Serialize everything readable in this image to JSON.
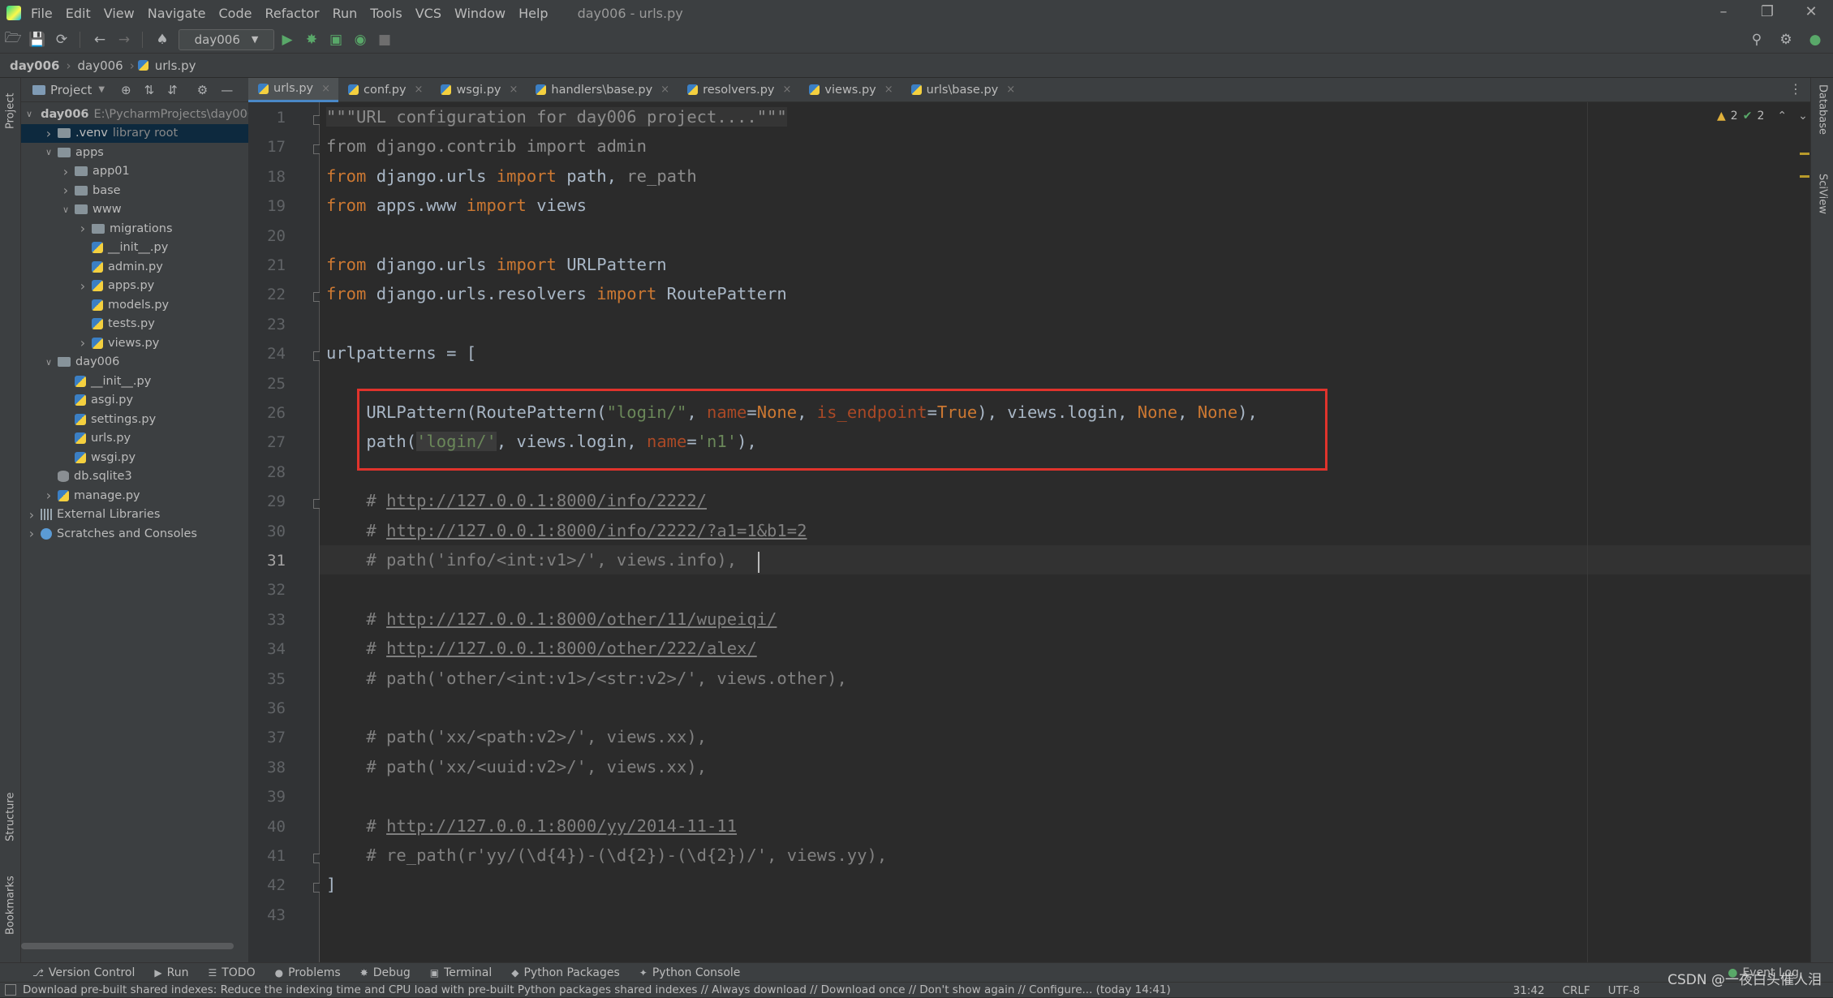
{
  "menu": {
    "items": [
      "File",
      "Edit",
      "View",
      "Navigate",
      "Code",
      "Refactor",
      "Run",
      "Tools",
      "VCS",
      "Window",
      "Help"
    ],
    "window_title": "day006 - urls.py"
  },
  "toolbar": {
    "run_config": "day006"
  },
  "breadcrumb": [
    "day006",
    "day006",
    "urls.py"
  ],
  "project_panel": {
    "title": "Project",
    "tree": [
      {
        "label": "day006",
        "extra": "E:\\PycharmProjects\\day006",
        "depth": 0,
        "expanded": true,
        "kind": "folder",
        "bold": true
      },
      {
        "label": ".venv",
        "extra": "library root",
        "depth": 1,
        "expanded": false,
        "kind": "folder",
        "selected": true
      },
      {
        "label": "apps",
        "depth": 1,
        "expanded": true,
        "kind": "folder"
      },
      {
        "label": "app01",
        "depth": 2,
        "expanded": false,
        "kind": "folder"
      },
      {
        "label": "base",
        "depth": 2,
        "expanded": false,
        "kind": "folder"
      },
      {
        "label": "www",
        "depth": 2,
        "expanded": true,
        "kind": "folder"
      },
      {
        "label": "migrations",
        "depth": 3,
        "expanded": false,
        "kind": "folder"
      },
      {
        "label": "__init__.py",
        "depth": 3,
        "kind": "py"
      },
      {
        "label": "admin.py",
        "depth": 3,
        "kind": "py"
      },
      {
        "label": "apps.py",
        "depth": 3,
        "expanded": false,
        "kind": "py"
      },
      {
        "label": "models.py",
        "depth": 3,
        "kind": "py"
      },
      {
        "label": "tests.py",
        "depth": 3,
        "kind": "py"
      },
      {
        "label": "views.py",
        "depth": 3,
        "expanded": false,
        "kind": "py"
      },
      {
        "label": "day006",
        "depth": 1,
        "expanded": true,
        "kind": "folder"
      },
      {
        "label": "__init__.py",
        "depth": 2,
        "kind": "py"
      },
      {
        "label": "asgi.py",
        "depth": 2,
        "kind": "py"
      },
      {
        "label": "settings.py",
        "depth": 2,
        "kind": "py"
      },
      {
        "label": "urls.py",
        "depth": 2,
        "kind": "py"
      },
      {
        "label": "wsgi.py",
        "depth": 2,
        "kind": "py"
      },
      {
        "label": "db.sqlite3",
        "depth": 1,
        "kind": "db"
      },
      {
        "label": "manage.py",
        "depth": 1,
        "expanded": false,
        "kind": "py"
      },
      {
        "label": "External Libraries",
        "depth": 0,
        "expanded": false,
        "kind": "lib"
      },
      {
        "label": "Scratches and Consoles",
        "depth": 0,
        "expanded": false,
        "kind": "scratch"
      }
    ]
  },
  "tabs": [
    {
      "label": "urls.py",
      "active": true
    },
    {
      "label": "conf.py"
    },
    {
      "label": "wsgi.py"
    },
    {
      "label": "handlers\\base.py"
    },
    {
      "label": "resolvers.py"
    },
    {
      "label": "views.py"
    },
    {
      "label": "urls\\base.py"
    }
  ],
  "inspections": {
    "warnings": "2",
    "ok": "2"
  },
  "editor": {
    "current_line": "31",
    "lines": [
      {
        "n": "1",
        "html": "<span class=\"docs\">\"\"\"URL configuration for day006 project....\"\"\"</span>",
        "fold": true
      },
      {
        "n": "17",
        "html": "<span class=\"grey\">from django.contrib import admin</span>",
        "fold": true
      },
      {
        "n": "18",
        "html": "<span class=\"kw\">from</span> django.urls <span class=\"kw\">import</span> path, <span class=\"grey\">re_path</span>"
      },
      {
        "n": "19",
        "html": "<span class=\"kw\">from</span> apps.www <span class=\"kw\">import</span> views"
      },
      {
        "n": "20",
        "html": ""
      },
      {
        "n": "21",
        "html": "<span class=\"kw\">from</span> django.urls <span class=\"kw\">import</span> URLPattern"
      },
      {
        "n": "22",
        "html": "<span class=\"kw\">from</span> django.urls.resolvers <span class=\"kw\">import</span> RoutePattern",
        "fold": true
      },
      {
        "n": "23",
        "html": ""
      },
      {
        "n": "24",
        "html": "urlpatterns = [",
        "fold": true
      },
      {
        "n": "25",
        "html": ""
      },
      {
        "n": "26",
        "html": "    URLPattern(RoutePattern(<span class=\"str\">\"login/\"</span>, <span class=\"kwarg\">name</span>=<span class=\"kw\">None</span>, <span class=\"kwarg\">is_endpoint</span>=<span class=\"kw\">True</span>), views.login, <span class=\"kw\">None</span>, <span class=\"kw\">None</span>),"
      },
      {
        "n": "27",
        "html": "    path(<span class=\"strhl\">'login/'</span>, views.login, <span class=\"kwarg\">name</span>=<span class=\"str\">'n1'</span>),"
      },
      {
        "n": "28",
        "html": ""
      },
      {
        "n": "29",
        "html": "    <span class=\"cm\"># </span><span class=\"link\">http://127.0.0.1:8000/info/2222/</span>",
        "fold": true
      },
      {
        "n": "30",
        "html": "    <span class=\"cm\"># </span><span class=\"link\">http://127.0.0.1:8000/info/2222/?a1=1&amp;b1=2</span>"
      },
      {
        "n": "31",
        "html": "    <span class=\"cm\"># path('info/&lt;int:v1&gt;/', views.info),</span>"
      },
      {
        "n": "32",
        "html": ""
      },
      {
        "n": "33",
        "html": "    <span class=\"cm\"># </span><span class=\"link\">http://127.0.0.1:8000/other/11/wupeiqi/</span>"
      },
      {
        "n": "34",
        "html": "    <span class=\"cm\"># </span><span class=\"link\">http://127.0.0.1:8000/other/222/alex/</span>"
      },
      {
        "n": "35",
        "html": "    <span class=\"cm\"># path('other/&lt;int:v1&gt;/&lt;str:v2&gt;/', views.other),</span>"
      },
      {
        "n": "36",
        "html": ""
      },
      {
        "n": "37",
        "html": "    <span class=\"cm\"># path('xx/&lt;path:v2&gt;/', views.xx),</span>"
      },
      {
        "n": "38",
        "html": "    <span class=\"cm\"># path('xx/&lt;uuid:v2&gt;/', views.xx),</span>"
      },
      {
        "n": "39",
        "html": ""
      },
      {
        "n": "40",
        "html": "    <span class=\"cm\"># </span><span class=\"link\">http://127.0.0.1:8000/yy/2014-11-11</span>"
      },
      {
        "n": "41",
        "html": "    <span class=\"cm\"># re_path(r'yy/(\\d{4})-(\\d{2})-(\\d{2})/', views.yy),</span>",
        "fold": true
      },
      {
        "n": "42",
        "html": "]",
        "fold": true
      },
      {
        "n": "43",
        "html": ""
      }
    ]
  },
  "right_strip": [
    "Database",
    "SciView"
  ],
  "left_strip": {
    "top": "Project",
    "mid": "Structure",
    "bottom": "Bookmarks"
  },
  "bottom_tools": [
    "Version Control",
    "Run",
    "TODO",
    "Problems",
    "Debug",
    "Terminal",
    "Python Packages",
    "Python Console"
  ],
  "event_log": "Event Log",
  "status": {
    "message": "Download pre-built shared indexes: Reduce the indexing time and CPU load with pre-built Python packages shared indexes // Always download // Download once // Don't show again // Configure... (today 14:41)",
    "position": "31:42",
    "line_sep": "CRLF",
    "encoding": "UTF-8"
  },
  "watermark": "CSDN @一夜白头催人泪"
}
